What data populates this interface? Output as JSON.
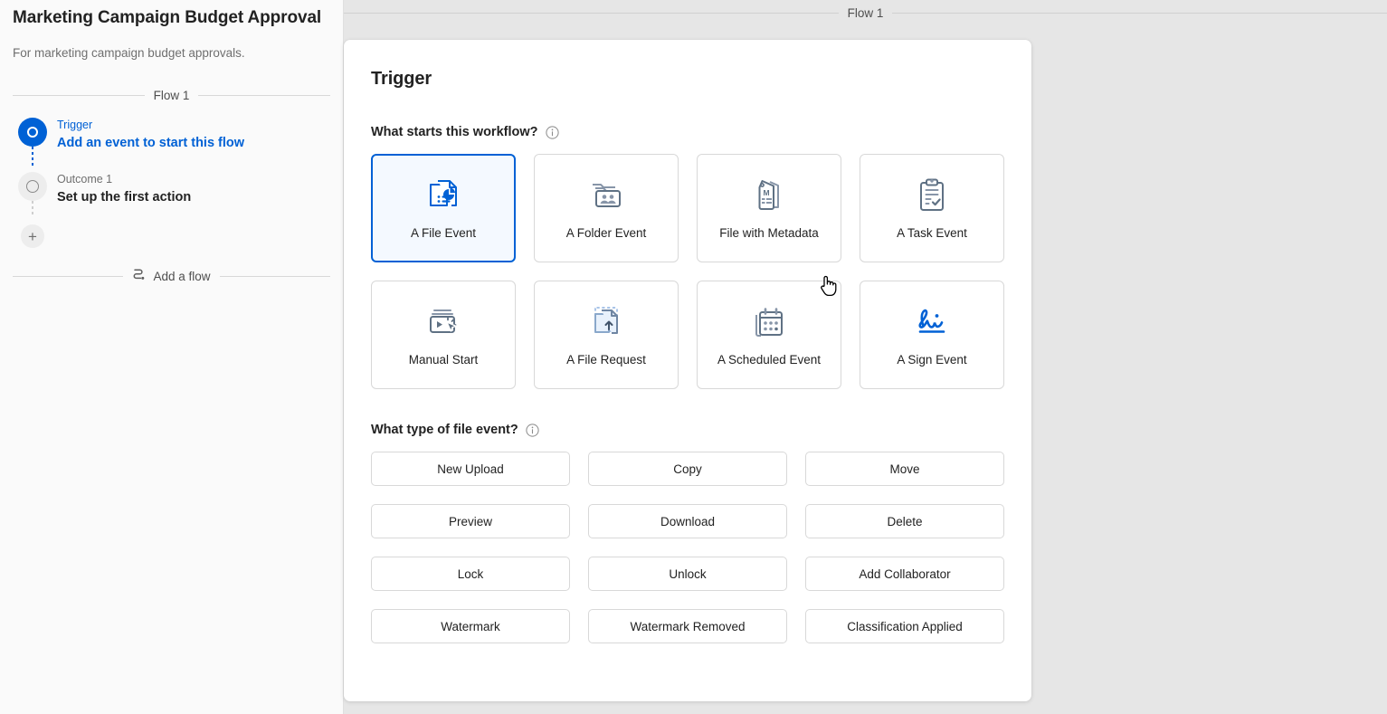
{
  "sidebar": {
    "workflow_title": "Marketing Campaign Budget Approval",
    "workflow_description": "For marketing campaign budget approvals.",
    "flow_label": "Flow 1",
    "nodes": [
      {
        "kicker": "Trigger",
        "title": "Add an event to start this flow",
        "state": "active"
      },
      {
        "kicker": "Outcome 1",
        "title": "Set up the first action",
        "state": "idle"
      }
    ],
    "add_step_glyph": "+",
    "add_flow_label": "Add a flow",
    "add_flow_icon": "flow-branch-icon"
  },
  "canvas": {
    "flow_label": "Flow 1"
  },
  "panel": {
    "title": "Trigger",
    "question_1": {
      "label": "What starts this workflow?",
      "info_icon": "info-circle-icon"
    },
    "event_cards": [
      {
        "label": "A File Event",
        "icon": "file-chart-icon",
        "selected": true
      },
      {
        "label": "A Folder Event",
        "icon": "folder-people-icon",
        "selected": false
      },
      {
        "label": "File with Metadata",
        "icon": "metadata-tag-icon",
        "selected": false
      },
      {
        "label": "A Task Event",
        "icon": "clipboard-check-icon",
        "selected": false
      },
      {
        "label": "Manual Start",
        "icon": "manual-click-icon",
        "selected": false
      },
      {
        "label": "A File Request",
        "icon": "file-upload-icon",
        "selected": false
      },
      {
        "label": "A Scheduled Event",
        "icon": "calendar-icon",
        "selected": false
      },
      {
        "label": "A Sign Event",
        "icon": "signature-icon",
        "selected": false
      }
    ],
    "question_2": {
      "label": "What type of file event?",
      "info_icon": "info-circle-icon"
    },
    "file_event_types": [
      "New Upload",
      "Copy",
      "Move",
      "Preview",
      "Download",
      "Delete",
      "Lock",
      "Unlock",
      "Add Collaborator",
      "Watermark",
      "Watermark Removed",
      "Classification Applied"
    ]
  },
  "colors": {
    "accent_blue": "#0061D5",
    "selected_card_bg": "#F4F9FF",
    "canvas_bg": "#E6E6E6",
    "sidebar_bg": "#FAFAFA",
    "icon_gray": "#6E7B8C",
    "text_primary": "#222222",
    "text_secondary": "#6F6F6F"
  },
  "cursor": {
    "type": "pointer-hand-cursor"
  }
}
